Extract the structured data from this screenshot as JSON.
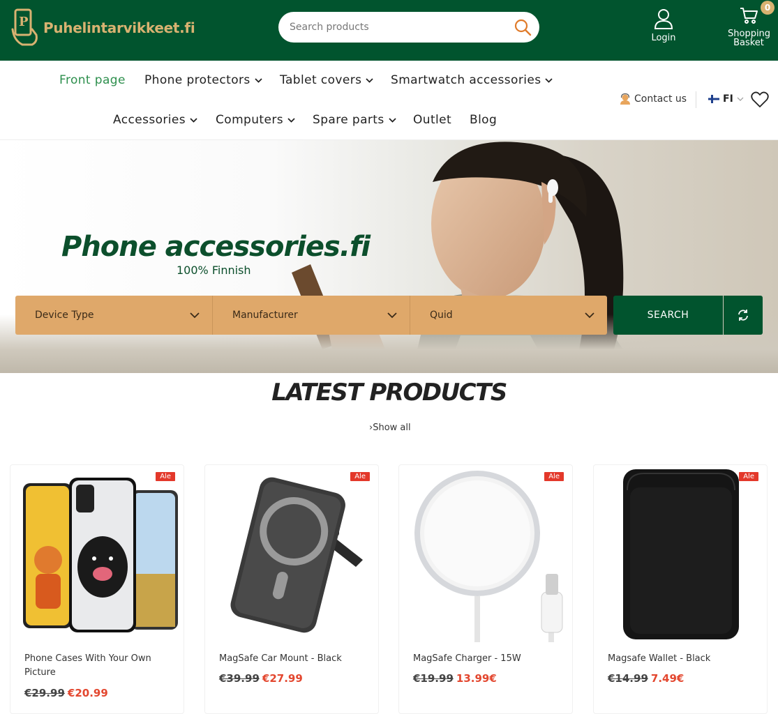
{
  "header": {
    "logo_text": "Puhelintarvikkeet.fi",
    "search_placeholder": "Search products",
    "login_label": "Login",
    "basket_label": "Shopping Basket",
    "basket_count": "0",
    "colors": {
      "header_bg": "#01542e",
      "brand_gold": "#d8b271"
    }
  },
  "nav": {
    "row1": [
      {
        "label": "Front page",
        "dropdown": false,
        "active": true
      },
      {
        "label": "Phone protectors",
        "dropdown": true
      },
      {
        "label": "Tablet covers",
        "dropdown": true
      },
      {
        "label": "Smartwatch accessories",
        "dropdown": true
      }
    ],
    "row2": [
      {
        "label": "Accessories",
        "dropdown": true
      },
      {
        "label": "Computers",
        "dropdown": true
      },
      {
        "label": "Spare parts",
        "dropdown": true
      },
      {
        "label": "Outlet",
        "dropdown": false
      },
      {
        "label": "Blog",
        "dropdown": false
      }
    ],
    "contact_label": "Contact us",
    "language": "FI"
  },
  "hero": {
    "title": "Phone accessories.fi",
    "subtitle": "100% Finnish",
    "filters": [
      "Device Type",
      "Manufacturer",
      "Quid"
    ],
    "search_label": "SEARCH",
    "colors": {
      "filter_bg": "#dfa86a",
      "search_bg": "#01542e"
    }
  },
  "latest": {
    "title": "LATEST PRODUCTS",
    "show_all": "Show all"
  },
  "products": [
    {
      "name": "Phone Cases With Your Own Picture",
      "old_price": "€29.99",
      "new_price": "€20.99",
      "badge": "Ale"
    },
    {
      "name": "MagSafe Car Mount - Black",
      "old_price": "€39.99",
      "new_price": "€27.99",
      "badge": "Ale"
    },
    {
      "name": "MagSafe Charger - 15W",
      "old_price": "€19.99",
      "new_price": "13.99€",
      "badge": "Ale"
    },
    {
      "name": "Magsafe Wallet - Black",
      "old_price": "€14.99",
      "new_price": "7.49€",
      "badge": "Ale"
    }
  ]
}
